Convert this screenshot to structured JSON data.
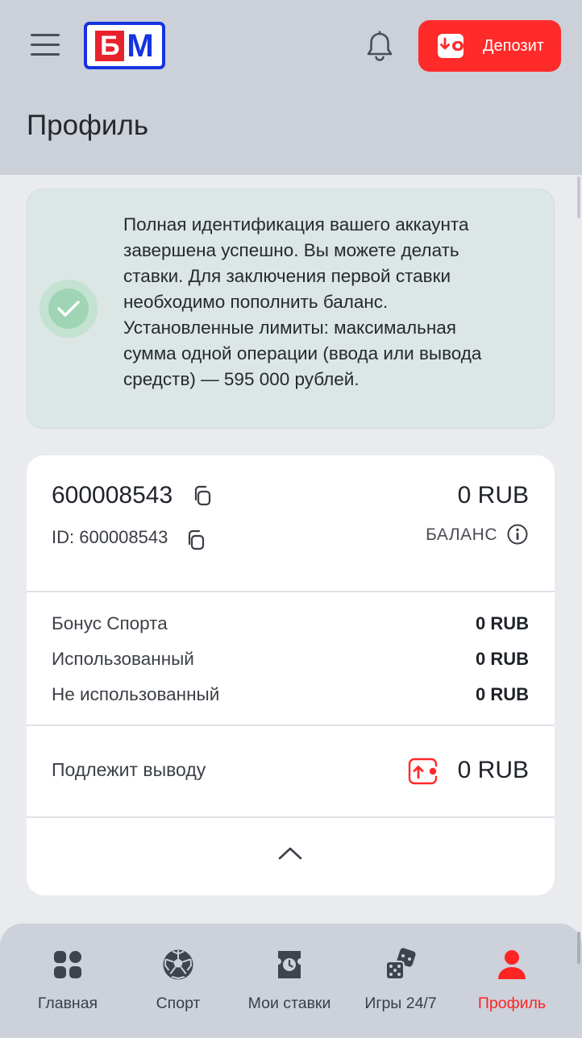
{
  "header": {
    "logo_left": "Б",
    "logo_right": "М",
    "deposit_label": "Депозит",
    "page_title": "Профиль"
  },
  "notice": {
    "icon": "check-icon",
    "lines": [
      "Полная идентификация вашего аккаунта",
      "завершена успешно. Вы можете делать",
      "ставки. Для заключения первой ставки",
      "необходимо пополнить баланс.",
      "Установленные лимиты: максимальная",
      "сумма одной операции (ввода или вывода",
      "средств) — 595 000 рублей."
    ]
  },
  "account": {
    "number": "600008543",
    "id_line": "ID: 600008543",
    "balance_value": "0 RUB",
    "balance_label": "БАЛАНС"
  },
  "bonus": {
    "rows": [
      {
        "label": "Бонус Спорта",
        "value": "0 RUB"
      },
      {
        "label": "Использованный",
        "value": "0 RUB"
      },
      {
        "label": "Не использованный",
        "value": "0 RUB"
      }
    ]
  },
  "withdraw": {
    "label": "Подлежит выводу",
    "value": "0 RUB"
  },
  "nav": {
    "items": [
      {
        "label": "Главная",
        "icon": "home-grid-icon"
      },
      {
        "label": "Спорт",
        "icon": "soccer-ball-icon"
      },
      {
        "label": "Мои ставки",
        "icon": "bet-ticket-icon"
      },
      {
        "label": "Игры 24/7",
        "icon": "dice-icon"
      },
      {
        "label": "Профиль",
        "icon": "user-icon"
      }
    ],
    "active": "Профиль"
  },
  "colors": {
    "accent": "#ff2a2a",
    "logo_blue": "#1633e0",
    "success_bg": "#dbe6e5",
    "header_bg": "#cbd0d9"
  }
}
